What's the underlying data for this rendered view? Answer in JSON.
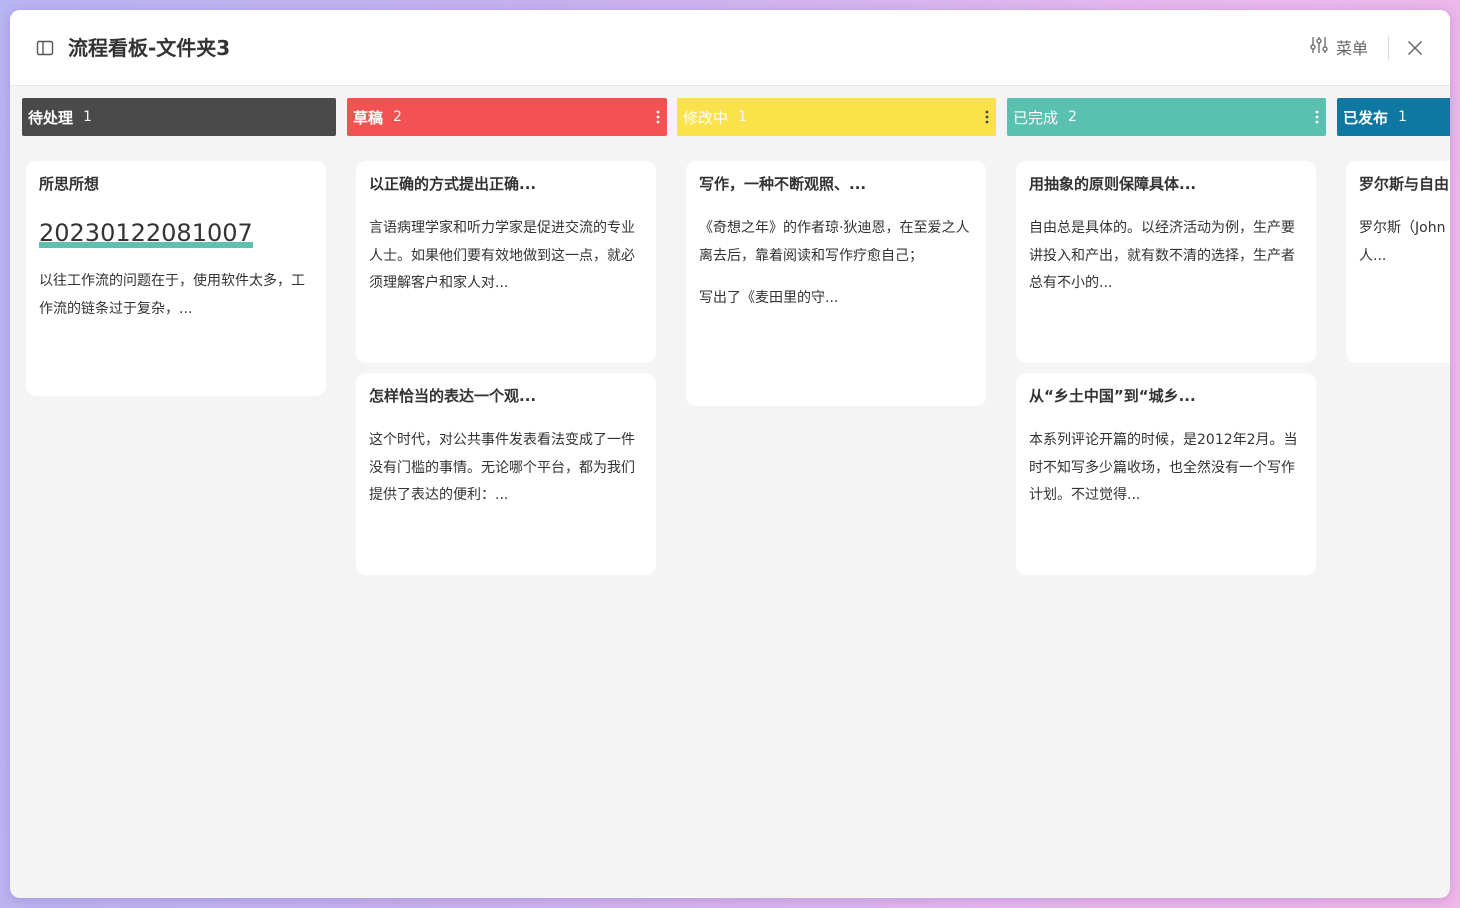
{
  "header": {
    "title": "流程看板-文件夹3",
    "menu_label": "菜单"
  },
  "columns": [
    {
      "name": "待处理",
      "count": "1",
      "color": "#4a4a4a",
      "cards": [
        {
          "title": "所思所想",
          "heading": "20230122081007",
          "paragraphs": [
            "以往工作流的问题在于，使用软件太多，工作流的链条过于复杂，..."
          ]
        }
      ]
    },
    {
      "name": "草稿",
      "count": "2",
      "color": "#f35252",
      "cards": [
        {
          "title": "以正确的方式提出正确...",
          "paragraphs": [
            "言语病理学家和听力学家是促进交流的专业人士。如果他们要有效地做到这一点，就必须理解客户和家人对..."
          ]
        },
        {
          "title": "怎样恰当的表达一个观...",
          "paragraphs": [
            "这个时代，对公共事件发表看法变成了一件没有门槛的事情。无论哪个平台，都为我们提供了表达的便利：..."
          ]
        }
      ]
    },
    {
      "name": "修改中",
      "count": "1",
      "color": "#fce24a",
      "cards": [
        {
          "title": "写作，一种不断观照、...",
          "paragraphs": [
            "《奇想之年》的作者琼·狄迪恩，在至爱之人离去后，靠着阅读和写作疗愈自己；",
            "写出了《麦田里的守..."
          ]
        }
      ]
    },
    {
      "name": "已完成",
      "count": "2",
      "color": "#5ac0b0",
      "cards": [
        {
          "title": "用抽象的原则保障具体...",
          "paragraphs": [
            "自由总是具体的。以经济活动为例，生产要讲投入和产出，就有数不清的选择，生产者总有不小的..."
          ]
        },
        {
          "title": "从“乡土中国”到“城乡...",
          "paragraphs": [
            "本系列评论开篇的时候，是2012年2月。当时不知写多少篇收场，也全然没有一个写作计划。不过觉得..."
          ]
        }
      ]
    },
    {
      "name": "已发布",
      "count": "1",
      "color": "#0e78a3",
      "cards": [
        {
          "title": "罗尔斯与自由",
          "paragraphs": [
            "罗尔斯（John Rawls）就斐然，受到不时有人..."
          ]
        }
      ]
    }
  ]
}
